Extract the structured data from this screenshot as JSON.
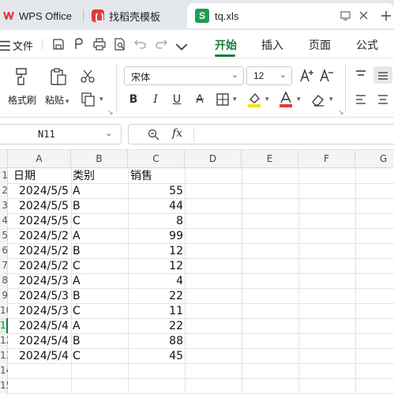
{
  "tabs": {
    "wps": "WPS Office",
    "template": "找稻壳模板",
    "file": "tq.xls",
    "file_icon_letter": "S"
  },
  "menu": {
    "file_label": "文件",
    "tabs": [
      "开始",
      "插入",
      "页面",
      "公式"
    ],
    "active_tab_index": 0
  },
  "ribbon": {
    "format_painter": "格式刷",
    "paste": "粘贴",
    "font_name": "宋体",
    "font_size": "12"
  },
  "formula_bar": {
    "name_box": "N11",
    "fx_label": "fx",
    "content": ""
  },
  "grid": {
    "columns": [
      "A",
      "B",
      "C",
      "D",
      "E",
      "F",
      "G"
    ],
    "row_numbers": [
      "1",
      "2",
      "3",
      "4",
      "5",
      "6",
      "7",
      "8",
      "9",
      "10",
      "11",
      "12",
      "13",
      "14",
      "15"
    ],
    "selected_row": "11",
    "headers": {
      "A": "日期",
      "B": "类别",
      "C": "销售"
    },
    "rows": [
      {
        "date": "2024/5/5",
        "cat": "A",
        "sales": "55"
      },
      {
        "date": "2024/5/5",
        "cat": "B",
        "sales": "44"
      },
      {
        "date": "2024/5/5",
        "cat": "C",
        "sales": "8"
      },
      {
        "date": "2024/5/2",
        "cat": "A",
        "sales": "99"
      },
      {
        "date": "2024/5/2",
        "cat": "B",
        "sales": "12"
      },
      {
        "date": "2024/5/2",
        "cat": "C",
        "sales": "12"
      },
      {
        "date": "2024/5/3",
        "cat": "A",
        "sales": "4"
      },
      {
        "date": "2024/5/3",
        "cat": "B",
        "sales": "22"
      },
      {
        "date": "2024/5/3",
        "cat": "C",
        "sales": "11"
      },
      {
        "date": "2024/5/4",
        "cat": "A",
        "sales": "22"
      },
      {
        "date": "2024/5/4",
        "cat": "B",
        "sales": "88"
      },
      {
        "date": "2024/5/4",
        "cat": "C",
        "sales": "45"
      }
    ]
  },
  "colors": {
    "accent": "#1b7a3d",
    "wps_red": "#e23b3b",
    "sheet_green": "#1f9d55"
  }
}
